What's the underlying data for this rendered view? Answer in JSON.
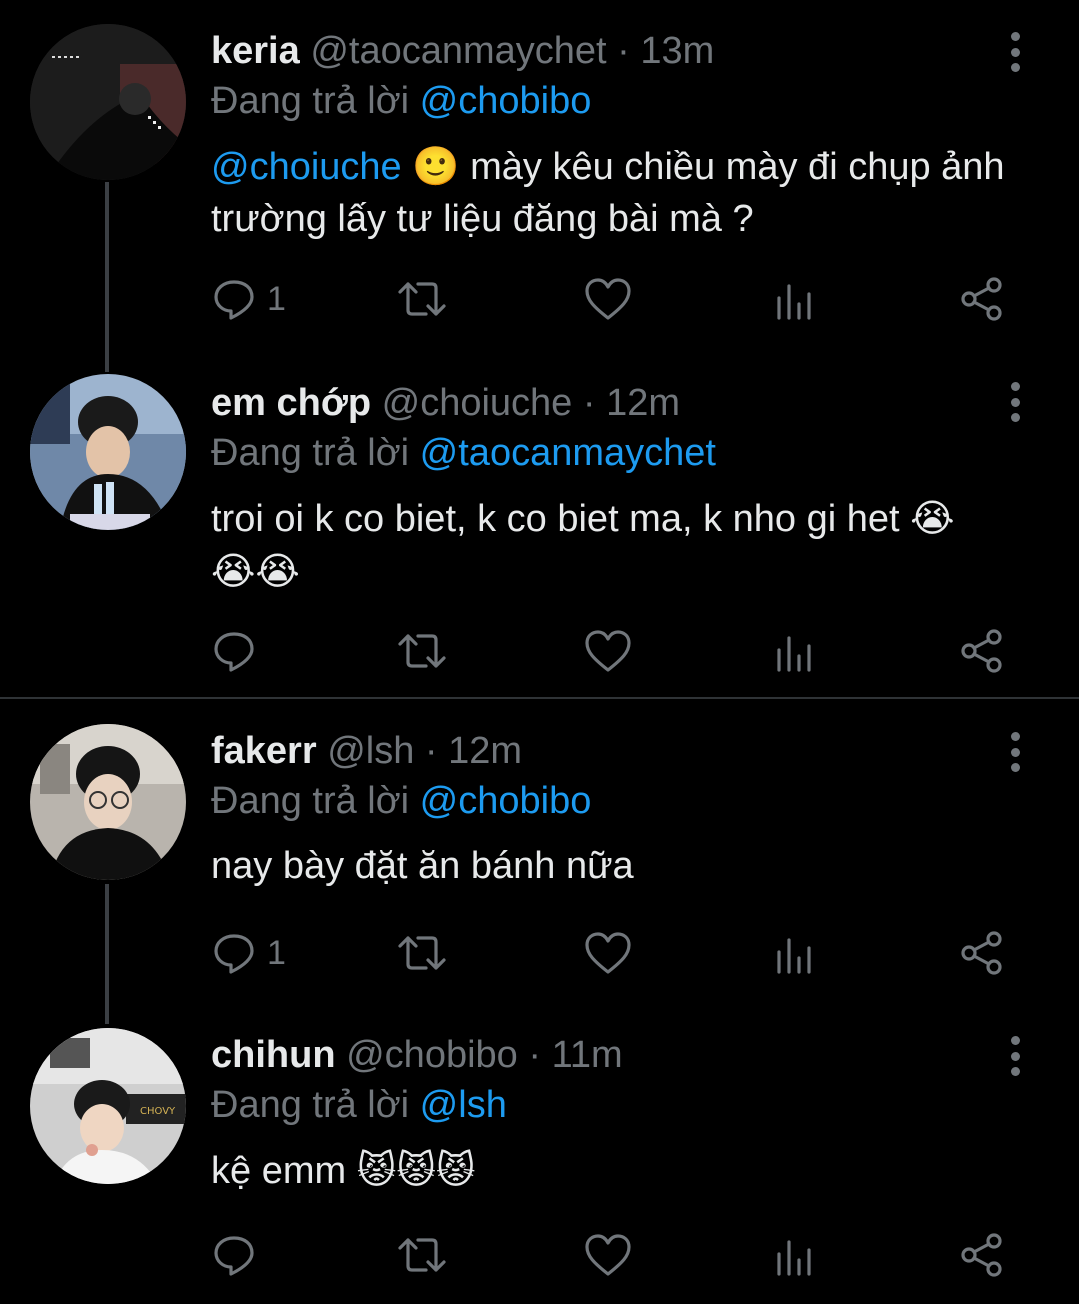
{
  "tweets": [
    {
      "name": "keria",
      "handle": "@taocanmaychet",
      "dot": "·",
      "time": "13m",
      "replying_prefix": "Đang trả lời",
      "replying_to": "@chobibo",
      "mention": "@choiuche",
      "emoji_a": "🙂",
      "text": "mày kêu chiều mày đi chụp ảnh trường lấy tư liệu đăng bài mà ?",
      "reply_count": "1"
    },
    {
      "name": "em chớp",
      "handle": "@choiuche",
      "dot": "·",
      "time": "12m",
      "replying_prefix": "Đang trả lời",
      "replying_to": "@taocanmaychet",
      "text": "troi oi k co biet, k co biet ma, k nho gi het",
      "emoji_a": "😭",
      "emoji_b": "😭😭",
      "reply_count": ""
    },
    {
      "name": "fakerr",
      "handle": "@lsh",
      "dot": "·",
      "time": "12m",
      "replying_prefix": "Đang trả lời",
      "replying_to": "@chobibo",
      "text": "nay bày đặt ăn bánh nữa",
      "reply_count": "1"
    },
    {
      "name": "chihun",
      "handle": "@chobibo",
      "dot": "·",
      "time": "11m",
      "replying_prefix": "Đang trả lời",
      "replying_to": "@lsh",
      "text": "kệ emm",
      "emoji_a": "😾😾😾",
      "reply_count": ""
    }
  ],
  "icons": {
    "reply": "reply-icon",
    "retweet": "retweet-icon",
    "like": "heart-icon",
    "views": "analytics-icon",
    "share": "share-icon",
    "more": "more-vertical-icon"
  },
  "colors": {
    "background": "#000000",
    "text": "#e7e9ea",
    "muted": "#71767b",
    "accent": "#1d9bf0"
  }
}
